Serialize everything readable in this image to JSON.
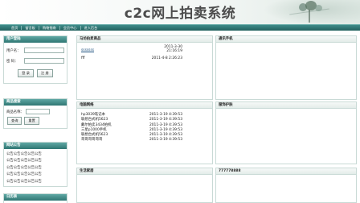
{
  "site": {
    "title": "c2c网上拍卖系统"
  },
  "nav": {
    "items": [
      "首页",
      "留言板",
      "购物指南",
      "会员中心",
      "进入后台"
    ]
  },
  "sidebar": {
    "login": {
      "title": "用户登陆",
      "username_label": "用户名：",
      "password_label": "密  码：",
      "login_button": "登  录",
      "register_button": "注  册"
    },
    "search": {
      "title": "商品搜索",
      "name_label": "商品名称：",
      "query_button": "查询",
      "reset_button": "重置"
    },
    "notice": {
      "title": "网站公告",
      "lines": [
        "公告公告公告公告公告",
        "公告公告公告公告公告",
        "公告公告公告公告公告",
        "公告公告公告公告公告",
        "公告公告公告公告公告"
      ]
    },
    "rank": {
      "title": "日历表"
    }
  },
  "sections": {
    "auction": {
      "title": "马坊拍卖商品",
      "item1": {
        "name": "sssssss",
        "date1": "2011-3-30",
        "date2": "21:16:19"
      },
      "item2": {
        "name": "fff",
        "date": "2011-4-8 2:26:23"
      }
    },
    "mobile": {
      "title": "通讯手机"
    },
    "computer": {
      "title": "电脑网络",
      "items": [
        {
          "name": "hp3039笔记本",
          "date": "2011-3-19 4:39:53"
        },
        {
          "name": "联想台式机5623",
          "date": "2011-3-19 4:39:53"
        },
        {
          "name": "戴尔拍卖3434拍机",
          "date": "2011-3-19 4:39:53"
        },
        {
          "name": "三星p1000手机",
          "date": "2011-3-19 4:39:53"
        },
        {
          "name": "联想台式机5623",
          "date": "2011-3-19 4:39:53"
        },
        {
          "name": "哥哥哥哥哥哥",
          "date": "2011-3-19 4:39:53"
        }
      ]
    },
    "clothing": {
      "title": "服饰护肤"
    },
    "home": {
      "title": "生活家居"
    },
    "misc": {
      "text": "777778888"
    }
  }
}
